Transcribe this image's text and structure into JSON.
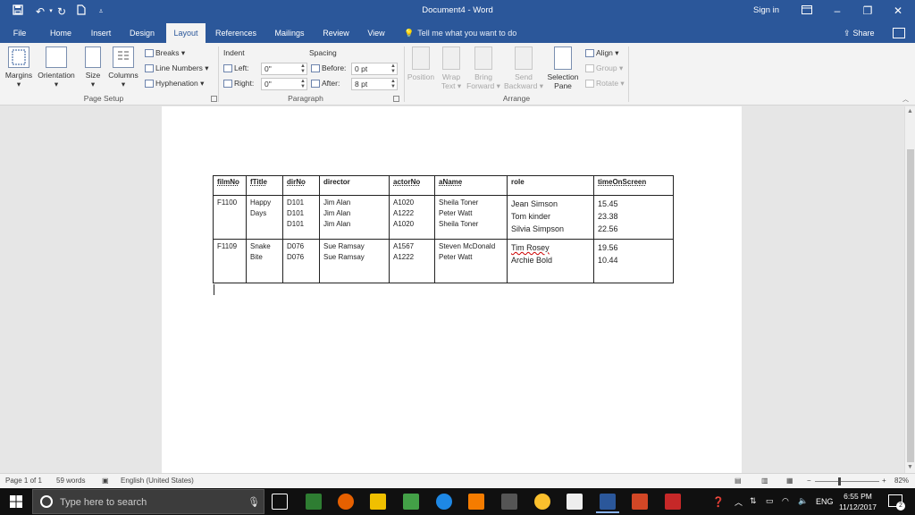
{
  "window": {
    "title": "Document4 - Word",
    "signin": "Sign in",
    "colors": {
      "word_blue": "#2b579a",
      "ribbon_bg": "#f3f3f3",
      "doc_bg": "#e6e6e6"
    },
    "quick_access_icons": [
      "save-icon",
      "undo-icon",
      "redo-icon",
      "new-document-icon",
      "customize-qat-icon"
    ],
    "window_controls": [
      "ribbon-display-options-icon",
      "minimize-icon",
      "restore-icon",
      "close-icon"
    ]
  },
  "tabs": [
    "File",
    "Home",
    "Insert",
    "Design",
    "Layout",
    "References",
    "Mailings",
    "Review",
    "View"
  ],
  "active_tab": "Layout",
  "tell_me": "Tell me what you want to do",
  "share": "Share",
  "ribbon": {
    "page_setup": {
      "label": "Page Setup",
      "margins": "Margins",
      "orientation": "Orientation",
      "size": "Size",
      "columns": "Columns",
      "breaks": "Breaks",
      "line_numbers": "Line Numbers",
      "hyphenation": "Hyphenation"
    },
    "paragraph": {
      "label": "Paragraph",
      "indent": "Indent",
      "spacing": "Spacing",
      "left_label": "Left:",
      "left_value": "0\"",
      "right_label": "Right:",
      "right_value": "0\"",
      "before_label": "Before:",
      "before_value": "0 pt",
      "after_label": "After:",
      "after_value": "8 pt"
    },
    "arrange": {
      "label": "Arrange",
      "position": "Position",
      "wrap_text_1": "Wrap",
      "wrap_text_2": "Text",
      "bring_forward_1": "Bring",
      "bring_forward_2": "Forward",
      "send_backward_1": "Send",
      "send_backward_2": "Backward",
      "selection_pane_1": "Selection",
      "selection_pane_2": "Pane",
      "align": "Align",
      "group": "Group",
      "rotate": "Rotate"
    }
  },
  "table": {
    "headers": [
      "filmNo",
      "fTitle",
      "dirNo",
      "director",
      "actorNo",
      "aName",
      "role",
      "timeOnScreen"
    ],
    "rows": [
      {
        "filmNo": "F1100",
        "fTitle": [
          "Happy",
          "Days"
        ],
        "dirNo": [
          "D101",
          "D101",
          "D101"
        ],
        "director": [
          "Jim Alan",
          "Jim Alan",
          "Jim Alan"
        ],
        "actorNo": [
          "A1020",
          "A1222",
          "A1020"
        ],
        "aName": [
          "Sheila Toner",
          "Peter Watt",
          "Sheila Toner"
        ],
        "role": [
          "Jean Simson",
          "Tom kinder",
          "Silvia Simpson"
        ],
        "timeOnScreen": [
          "15.45",
          "23.38",
          "22.56"
        ]
      },
      {
        "filmNo": "F1109",
        "fTitle": [
          "Snake",
          "Bite"
        ],
        "dirNo": [
          "D076",
          "D076"
        ],
        "director": [
          "Sue Ramsay",
          "Sue Ramsay"
        ],
        "actorNo": [
          "A1567",
          "A1222"
        ],
        "aName": [
          "Steven McDonald",
          "Peter Watt"
        ],
        "role": [
          "Tim Rosey",
          "Archie Bold"
        ],
        "timeOnScreen": [
          "19.56",
          "10.44"
        ]
      }
    ]
  },
  "status": {
    "page": "Page 1 of 1",
    "words": "59 words",
    "language": "English (United States)",
    "zoom": "82%"
  },
  "taskbar": {
    "search_placeholder": "Type here to search",
    "language": "ENG",
    "time": "6:55 PM",
    "date": "11/12/2017",
    "notification_count": "2"
  }
}
